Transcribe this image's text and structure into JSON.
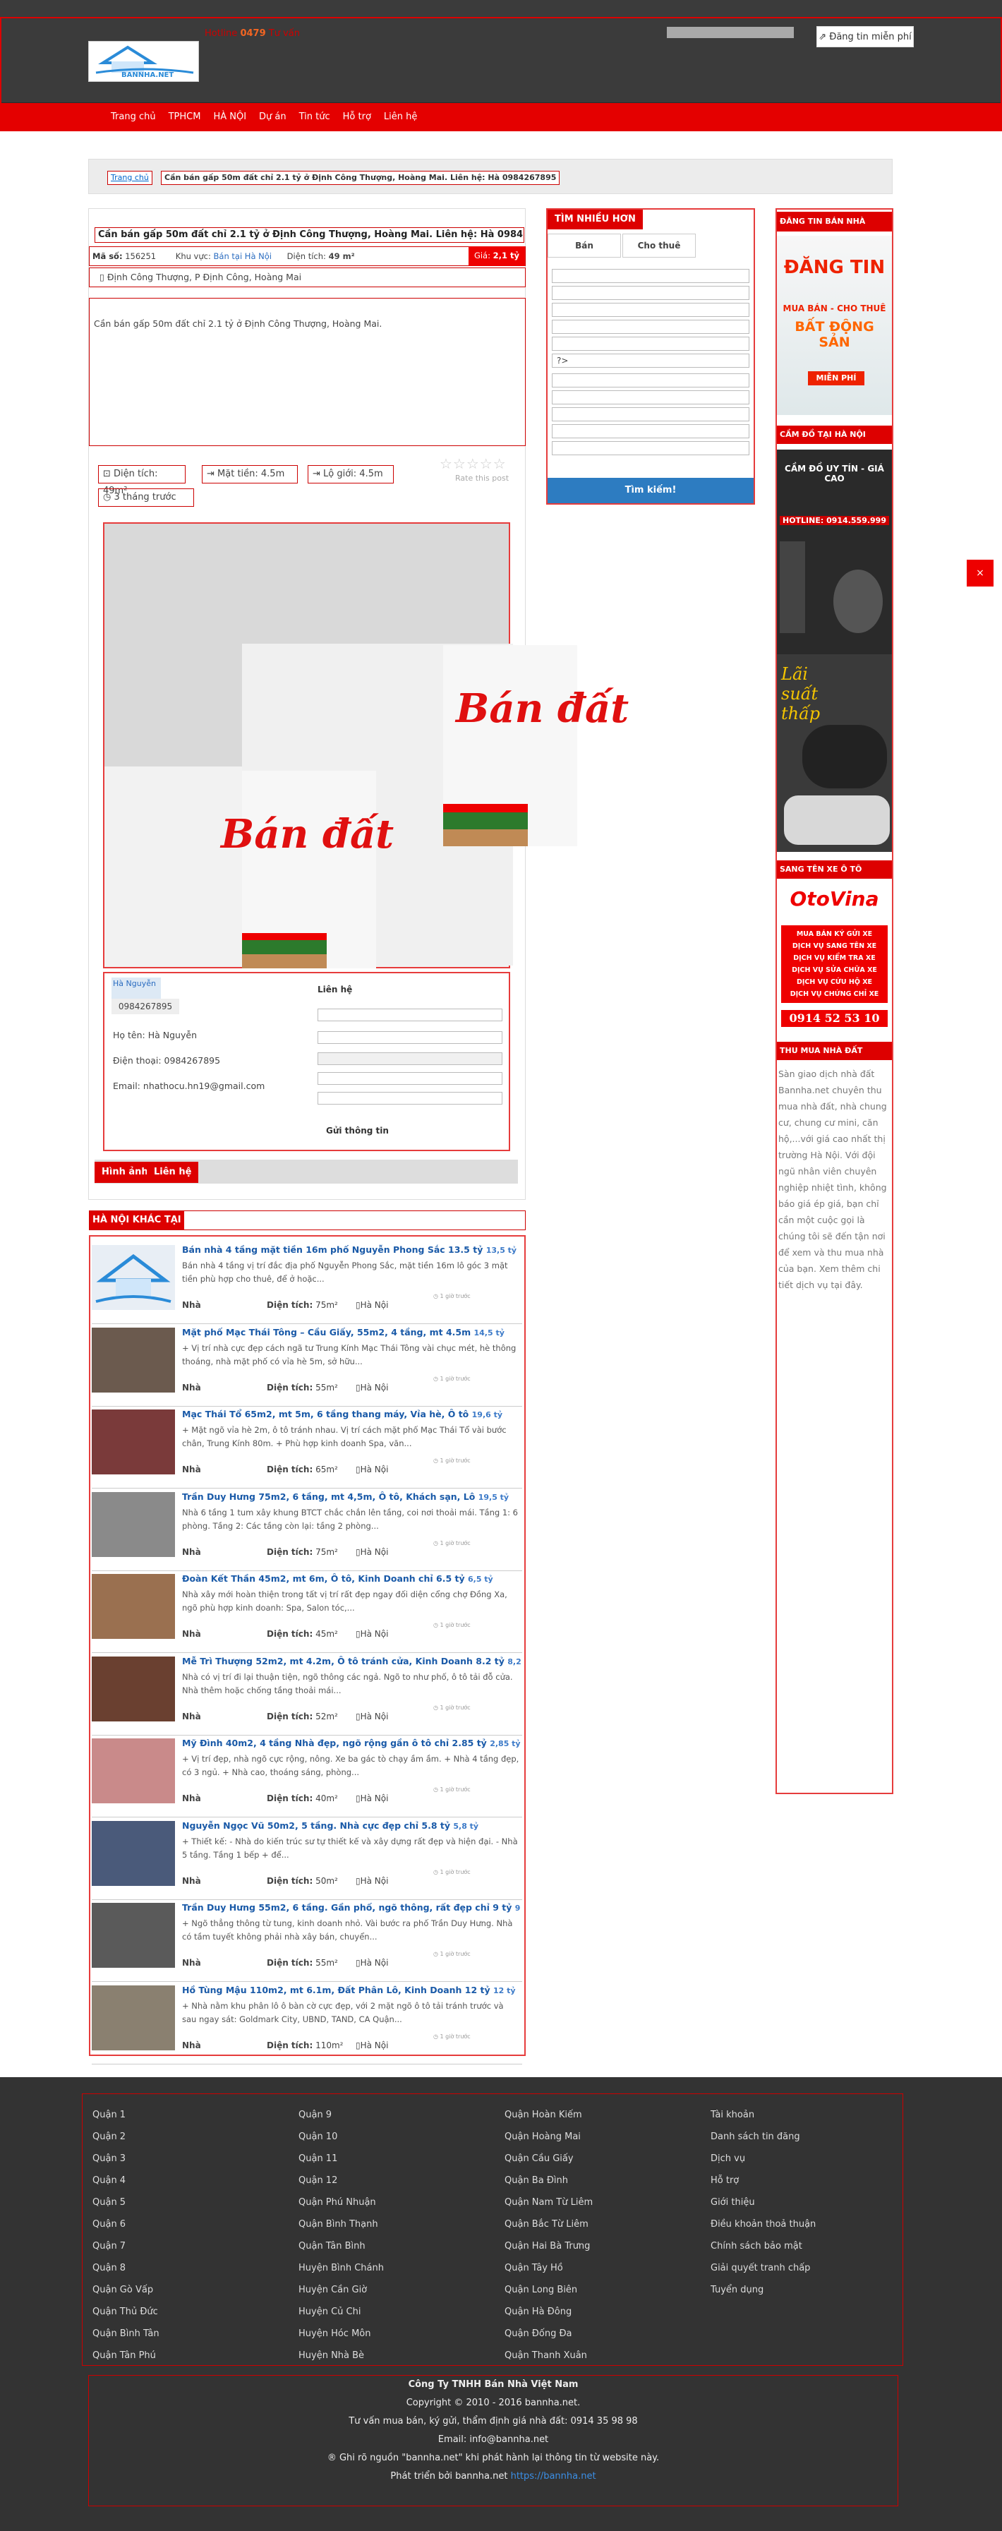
{
  "header": {
    "hotline_label": "Hotline",
    "hotline_number": "0479",
    "tagline": "Tư vấn",
    "post_label": "Đăng tin miễn phí",
    "logo_text": "BANNHA.NET",
    "brand": "#e40000"
  },
  "nav": [
    "Trang chủ",
    "TPHCM",
    "HÀ NỘI",
    "Dự án",
    "Tin tức",
    "Hỗ trợ",
    "Liên hệ"
  ],
  "breadcrumb": {
    "home": "Trang chủ",
    "current": "Cần bán gấp 50m đất chỉ 2.1 tỷ ở Định Công Thượng, Hoàng Mai. Liên hệ: Hà 0984267895"
  },
  "post": {
    "title": "Cần bán gấp 50m đất chỉ 2.1 tỷ ở Định Công Thượng, Hoàng Mai. Liên hệ: Hà 0984267895",
    "code_label": "Mã số:",
    "code": "156251",
    "area_label": "Khu vực:",
    "area": "Bán tại Hà Nội",
    "size_label": "Diện tích:",
    "size": "49 m²",
    "price_label": "Giá:",
    "price": "2,1 tỷ",
    "location": "Định Công Thượng, P Định Công, Hoàng Mai",
    "desc": "Cần bán gấp 50m đất chỉ 2.1 tỷ ở Định Công Thượng, Hoàng Mai.",
    "features": [
      "Diện tích: 49m²",
      "Mặt tiền: 4.5m",
      "Lộ giới: 4.5m",
      "3 tháng trước"
    ],
    "rate": "Rate this post",
    "gallery_text": "Bán đất"
  },
  "contact": {
    "name_label": "Họ tên:",
    "name": "Hà Nguyễn",
    "phone_label": "Điện thoại:",
    "phone": "0984267895",
    "email_label": "Email:",
    "email": "nhathocu.hn19@gmail.com",
    "avatar_name": "Hà Nguyễn",
    "phone_badge": "0984267895",
    "form_title": "Liên hệ",
    "send": "Gửi thông tin"
  },
  "tabs": [
    "Hình ảnh",
    "Liên hệ"
  ],
  "search": {
    "title": "TÌM NHIỀU HƠN",
    "tab_sell": "Bán",
    "tab_rent": "Cho thuê",
    "button": "Tìm kiếm!"
  },
  "related": {
    "title": "HÀ NỘI KHÁC TẠI",
    "items": [
      {
        "title": "Bán nhà 4 tầng mặt tiền 16m phố Nguyễn Phong Sắc 13.5 tỷ",
        "price": "13,5 tỷ",
        "desc": "Bán nhà 4 tầng vị trí đắc địa phố Nguyễn Phong Sắc, mặt tiền 16m lô góc 3 mặt tiền phù hợp cho thuê, để ở hoặc...",
        "type": "Nhà",
        "area": "75m²",
        "city": "Hà Nội",
        "thumb": "#e8eef5"
      },
      {
        "title": "Mặt phố Mạc Thái Tông – Cầu Giấy, 55m2, 4 tầng, mt 4.5m",
        "price": "14,5 tỷ",
        "desc": "+ Vị trí nhà cực đẹp cách ngã tư Trung Kính Mạc Thái Tông vài chục mét, hè thông thoáng, nhà mặt phố có vỉa hè 5m, sở hữu...",
        "type": "Nhà",
        "area": "55m²",
        "city": "Hà Nội",
        "thumb": "#6b5a4e"
      },
      {
        "title": "Mạc Thái Tổ 65m2, mt 5m, 6 tầng thang máy, Vỉa hè, Ô tô",
        "price": "19,6 tỷ",
        "desc": "+ Mặt ngõ vỉa hè 2m, ô tô tránh nhau. Vị trí cách mặt phố Mạc Thái Tổ vài bước chân, Trung Kính 80m. + Phù hợp kinh doanh Spa, văn...",
        "type": "Nhà",
        "area": "65m²",
        "city": "Hà Nội",
        "thumb": "#7a3a3a"
      },
      {
        "title": "Trần Duy Hưng 75m2, 6 tầng, mt 4,5m, Ô tô, Khách sạn, Lô",
        "price": "19,5 tỷ",
        "desc": "Nhà 6 tầng 1 tum xây khung BTCT chắc chắn lên tầng, coi nơi thoải mái. Tầng 1: 6 phòng. Tầng 2: Các tầng còn lại: tầng 2 phòng...",
        "type": "Nhà",
        "area": "75m²",
        "city": "Hà Nội",
        "thumb": "#8a8a8a"
      },
      {
        "title": "Đoàn Kết Thần 45m2, mt 6m, Ô tô, Kinh Doanh chỉ 6.5 tỷ",
        "price": "6,5 tỷ",
        "desc": "Nhà xây mới hoàn thiện trong tất vị trí rất đẹp ngay đối diện cổng chợ Đồng Xa, ngõ phù hợp kinh doanh: Spa, Salon tóc,...",
        "type": "Nhà",
        "area": "45m²",
        "city": "Hà Nội",
        "thumb": "#9a7050"
      },
      {
        "title": "Mễ Trì Thượng 52m2, mt 4.2m, Ô tô tránh cửa, Kinh Doanh 8.2 tỷ",
        "price": "8,2 tỷ",
        "desc": "Nhà có vị trí đi lại thuận tiện, ngõ thông các ngả. Ngõ to như phố, ô tô tải đỗ cửa. Nhà thêm hoặc chống tầng thoải mái...",
        "type": "Nhà",
        "area": "52m²",
        "city": "Hà Nội",
        "thumb": "#6a4030"
      },
      {
        "title": "Mỹ Đình 40m2, 4 tầng Nhà đẹp, ngõ rộng gần ô tô chỉ 2.85 tỷ",
        "price": "2,85 tỷ",
        "desc": "+ Vị trí đẹp, nhà ngõ cực rộng, nông. Xe ba gác tò chạy ầm ầm. + Nhà 4 tầng đẹp, có 3 ngủ. + Nhà cao, thoáng sáng, phòng...",
        "type": "Nhà",
        "area": "40m²",
        "city": "Hà Nội",
        "thumb": "#c98a8a"
      },
      {
        "title": "Nguyễn Ngọc Vũ 50m2, 5 tầng. Nhà cực đẹp chỉ 5.8 tỷ",
        "price": "5,8 tỷ",
        "desc": "+ Thiết kế: - Nhà do kiến trúc sư tự thiết kế và xây dựng rất đẹp và hiện đại. - Nhà 5 tầng. Tầng 1 bếp + để...",
        "type": "Nhà",
        "area": "50m²",
        "city": "Hà Nội",
        "thumb": "#4a5a7a"
      },
      {
        "title": "Trần Duy Hưng 55m2, 6 tầng. Gần phố, ngõ thông, rất đẹp chỉ 9 tỷ",
        "price": "9 tỷ",
        "desc": "+ Ngõ thẳng thông từ tung, kinh doanh nhỏ. Vài bước ra phố Trần Duy Hưng. Nhà có tầm tuyết không phải nhà xây bán, chuyển...",
        "type": "Nhà",
        "area": "55m²",
        "city": "Hà Nội",
        "thumb": "#5a5a5a"
      },
      {
        "title": "Hồ Tùng Mậu 110m2, mt 6.1m, Đất Phân Lô, Kinh Doanh 12 tỷ",
        "price": "12 tỷ",
        "desc": "+ Nhà nằm khu phân lô ô bàn cờ cực đẹp, với 2 mặt ngõ ô tô tải tránh trước và sau ngay sát: Goldmark City, UBND, TAND, CA Quận...",
        "type": "Nhà",
        "area": "110m²",
        "city": "Hà Nội",
        "thumb": "#8a8070"
      }
    ],
    "area_label": "Diện tích:",
    "time": "1 giờ trước"
  },
  "sidebar": {
    "ad1_title": "ĐĂNG TIN BÁN NHÀ",
    "ad1_big": "ĐĂNG TIN",
    "ad1_sub": "MUA BÁN - CHO THUÊ",
    "ad1_big2": "BẤT ĐỘNG SẢN",
    "ad1_free": "MIỄN PHÍ",
    "ad2_title": "CẦM ĐỒ TẠI HÀ NỘI",
    "ad2_text": "CẦM ĐỒ UY TÍN - GIÁ CAO",
    "ad2_hotline": "HOTLINE: 0914.559.999",
    "ad2_rate": "Lãi suất thấp",
    "ad3_title": "SANG TÊN XE Ô TÔ",
    "ad3_brand": "OtoVina",
    "ad3_lines": [
      "MUA BÁN KÝ GỬI XE",
      "DỊCH VỤ SANG TÊN XE",
      "DỊCH VỤ KIỂM TRA XE",
      "DỊCH VỤ SỬA CHỮA XE",
      "DỊCH VỤ CỨU HỘ XE",
      "DỊCH VỤ CHỨNG CHỈ XE"
    ],
    "ad3_phone": "0914 52 53 10",
    "ad4_title": "THU MUA NHÀ ĐẤT",
    "ad4_text": "Sàn giao dịch nhà đất Bannha.net chuyên thu mua nhà đất, nhà chung cư, chung cư mini, căn hộ,...với giá cao nhất thị trường Hà Nội. Với đội ngũ nhân viên chuyên nghiệp nhiệt tình, không báo giá ép giá, bạn chỉ cần một cuộc gọi là chúng tôi sẽ đến tận nơi để xem và thu mua nhà của bạn. Xem thêm chi tiết dịch vụ tại đây."
  },
  "footer": {
    "col1": [
      "Quận 1",
      "Quận 2",
      "Quận 3",
      "Quận 4",
      "Quận 5",
      "Quận 6",
      "Quận 7",
      "Quận 8",
      "Quận Gò Vấp",
      "Quận Thủ Đức",
      "Quận Bình Tân",
      "Quận Tân Phú"
    ],
    "col2": [
      "Quận 9",
      "Quận 10",
      "Quận 11",
      "Quận 12",
      "Quận Phú Nhuận",
      "Quận Bình Thạnh",
      "Quận Tân Bình",
      "Huyện Bình Chánh",
      "Huyện Cần Giờ",
      "Huyện Củ Chi",
      "Huyện Hóc Môn",
      "Huyện Nhà Bè"
    ],
    "col3": [
      "Quận Hoàn Kiếm",
      "Quận Hoàng Mai",
      "Quận Cầu Giấy",
      "Quận Ba Đình",
      "Quận Nam Từ Liêm",
      "Quận Bắc Từ Liêm",
      "Quận Hai Bà Trưng",
      "Quận Tây Hồ",
      "Quận Long Biên",
      "Quận Hà Đông",
      "Quận Đống Đa",
      "Quận Thanh Xuân"
    ],
    "col4": [
      "Tài khoản",
      "Danh sách tin đăng",
      "Dịch vụ",
      "Hỗ trợ",
      "Giới thiệu",
      "Điều khoản thoả thuận",
      "Chính sách bảo mật",
      "Giải quyết tranh chấp",
      "Tuyển dụng"
    ],
    "company": "Công Ty TNHH Bán Nhà Việt Nam",
    "copyright": "Copyright © 2010 - 2016 bannha.net.",
    "line1": "Tư vấn mua bán, ký gửi, thẩm định giá nhà đất: 0914 35 98 98",
    "email": "Email: info@bannha.net",
    "note": "® Ghi rõ nguồn \"bannha.net\" khi phát hành lại thông tin từ website này.",
    "dev_prefix": "Phát triển bởi bannha.net",
    "dev_link": "https://bannha.net"
  }
}
